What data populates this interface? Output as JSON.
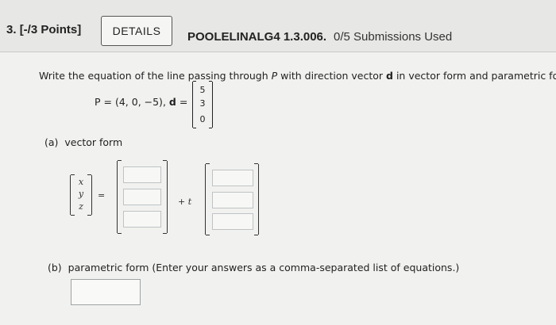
{
  "header": {
    "question_number": "3.",
    "points": "[-/3 Points]",
    "details_label": "DETAILS",
    "assignment_code": "POOLELINALG4 1.3.006.",
    "submissions": "0/5 Submissions Used"
  },
  "question": {
    "prompt_before_P": "Write the equation of the line passing through ",
    "P": "P",
    "prompt_mid": " with direction vector ",
    "d": "d",
    "prompt_end": " in vector form and parametric form.",
    "given_P": "P = (4, 0, −5),",
    "given_d": "d",
    "given_eq": "=",
    "d_vector": [
      "5",
      "3",
      "0"
    ]
  },
  "part_a": {
    "label": "(a)",
    "text": "vector form",
    "variables": [
      "x",
      "y",
      "z"
    ],
    "equals": "=",
    "plus_t": "+",
    "t": "t",
    "point_inputs": [
      "",
      "",
      ""
    ],
    "direction_inputs": [
      "",
      "",
      ""
    ]
  },
  "part_b": {
    "label": "(b)",
    "text": "parametric form (Enter your answers as a comma-separated list of equations.)",
    "answer": ""
  }
}
